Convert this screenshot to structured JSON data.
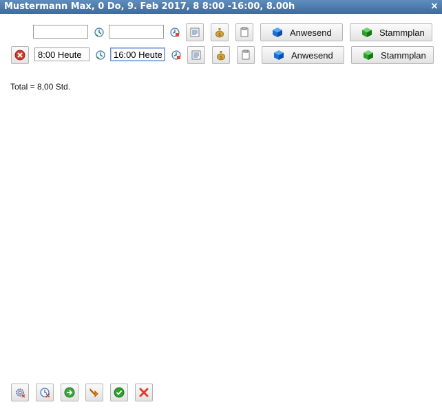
{
  "window": {
    "title": "Mustermann Max, 0 Do, 9. Feb 2017, 8 8:00 -16:00, 8.00h",
    "close_glyph": "×"
  },
  "rows": [
    {
      "start_value": "",
      "end_value": "",
      "has_delete": false,
      "anwesend_label": "Anwesend",
      "stammplan_label": "Stammplan"
    },
    {
      "start_value": "8:00 Heute",
      "end_value": "16:00 Heute",
      "has_delete": true,
      "anwesend_label": "Anwesend",
      "stammplan_label": "Stammplan"
    }
  ],
  "summary": {
    "total": "Total = 8,00 Std."
  },
  "icons": {
    "delete": "delete-icon",
    "clock_start": "clock-start-icon",
    "clock_end": "clock-end-icon",
    "notes": "notes-icon",
    "money": "money-bag-icon",
    "document": "document-icon",
    "anwesend": "blue-cube-icon",
    "stammplan": "green-cube-icon"
  },
  "bottom_toolbar": [
    "settings-icon",
    "calendar-icon",
    "next-icon",
    "export-icon",
    "confirm-icon",
    "cancel-icon"
  ],
  "colors": {
    "titlebar": "#4f7eb0",
    "anwesend_cube": "#1a6fd6",
    "stammplan_cube": "#2aa02a",
    "delete_red": "#d33a2c",
    "ok_green": "#2fa12f"
  }
}
